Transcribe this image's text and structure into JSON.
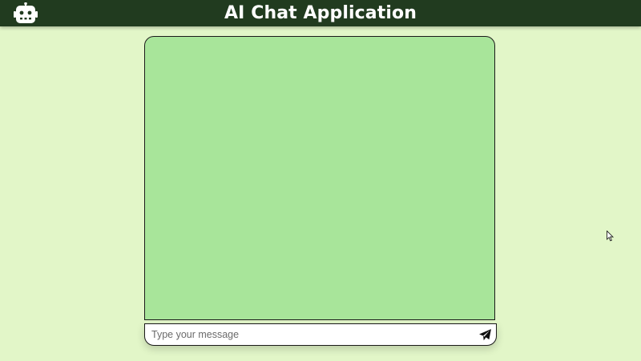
{
  "header": {
    "title": "AI Chat Application",
    "logo_icon": "robot-icon",
    "background": "#213b1f",
    "title_color": "#ffffff"
  },
  "chat": {
    "messages": [],
    "background": "#a8e59a"
  },
  "composer": {
    "placeholder": "Type your message",
    "value": "",
    "send_icon": "paper-plane-icon"
  },
  "page": {
    "background": "#e2f6c8"
  }
}
